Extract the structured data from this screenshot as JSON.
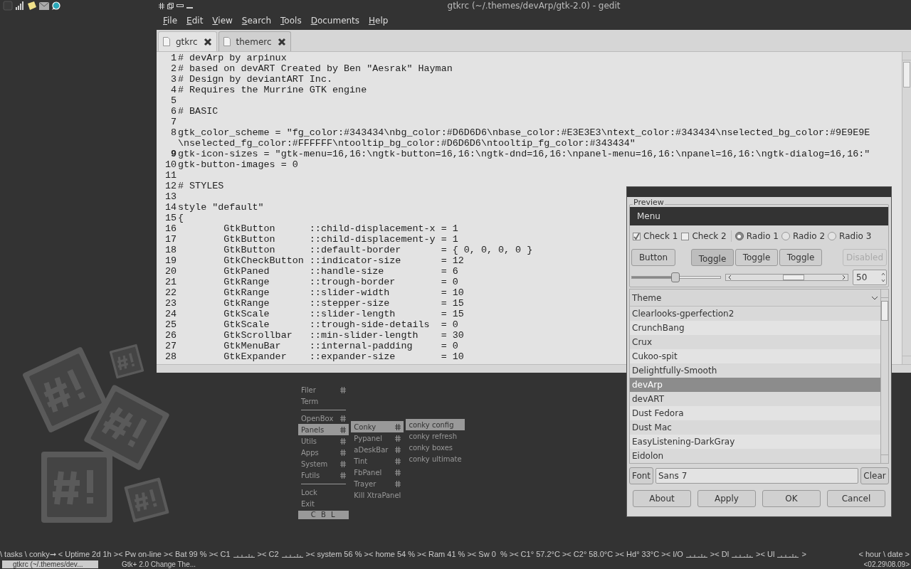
{
  "gedit": {
    "title": "gtkrc (~/.themes/devArp/gtk-2.0) - gedit",
    "menu": [
      "File",
      "Edit",
      "View",
      "Search",
      "Tools",
      "Documents",
      "Help"
    ],
    "tabs": [
      {
        "label": "gtkrc",
        "selected": true
      },
      {
        "label": "themerc",
        "selected": false
      }
    ],
    "lines": [
      {
        "number": "1",
        "text": "# devArp by arpinux",
        "current": false
      },
      {
        "number": "2",
        "text": "# based on devART Created by Ben \"Aesrak\" Hayman",
        "current": false
      },
      {
        "number": "3",
        "text": "# Design by deviantART Inc.",
        "current": false
      },
      {
        "number": "4",
        "text": "# Requires the Murrine GTK engine",
        "current": false
      },
      {
        "number": "5",
        "current": false
      },
      {
        "number": "6",
        "text": "# BASIC",
        "current": false
      },
      {
        "number": "7",
        "current": false
      },
      {
        "number": "8",
        "text": "gtk_color_scheme = \"fg_color:#343434\\nbg_color:#D6D6D6\\nbase_color:#E3E3E3\\ntext_color:#343434\\nselected_bg_color:#9E9E9E",
        "continuation": "\\nselected_fg_color:#FFFFFF\\ntooltip_bg_color:#D6D6D6\\ntooltip_fg_color:#343434\"",
        "current": false
      },
      {
        "number": "9",
        "text": "gtk-icon-sizes = \"gtk-menu=16,16:\\ngtk-button=16,16:\\ngtk-dnd=16,16:\\npanel-menu=16,16:\\npanel=16,16:\\ngtk-dialog=16,16:\"",
        "current": true
      },
      {
        "number": "10",
        "text": "gtk-button-images = 0",
        "current": false
      },
      {
        "number": "11",
        "current": false
      },
      {
        "number": "12",
        "text": "# STYLES",
        "current": false
      },
      {
        "number": "13",
        "current": false
      },
      {
        "number": "14",
        "text": "style \"default\"",
        "current": false
      },
      {
        "number": "15",
        "text": "{",
        "current": false
      },
      {
        "number": "16",
        "text": "\tGtkButton      ::child-displacement-x = 1",
        "current": false
      },
      {
        "number": "17",
        "text": "\tGtkButton      ::child-displacement-y = 1",
        "current": false
      },
      {
        "number": "18",
        "text": "\tGtkButton      ::default-border       = { 0, 0, 0, 0 }",
        "current": false
      },
      {
        "number": "19",
        "text": "\tGtkCheckButton ::indicator-size       = 12",
        "current": false
      },
      {
        "number": "20",
        "text": "\tGtkPaned       ::handle-size          = 6",
        "current": false
      },
      {
        "number": "21",
        "text": "\tGtkRange       ::trough-border        = 0",
        "current": false
      },
      {
        "number": "22",
        "text": "\tGtkRange       ::slider-width         = 10",
        "current": false
      },
      {
        "number": "23",
        "text": "\tGtkRange       ::stepper-size         = 15",
        "current": false
      },
      {
        "number": "24",
        "text": "\tGtkScale       ::slider-length        = 15",
        "current": false
      },
      {
        "number": "25",
        "text": "\tGtkScale       ::trough-side-details  = 0",
        "current": false
      },
      {
        "number": "26",
        "text": "\tGtkScrollbar   ::min-slider-length    = 30",
        "current": false
      },
      {
        "number": "27",
        "text": "\tGtkMenuBar     ::internal-padding     = 0",
        "current": false
      },
      {
        "number": "28",
        "text": "\tGtkExpander    ::expander-size        = 10",
        "current": false
      }
    ]
  },
  "menus": [
    {
      "items": [
        {
          "kind": "item",
          "label": "Filer",
          "submenu": true,
          "selected": false
        },
        {
          "kind": "item",
          "label": "Term",
          "submenu": false,
          "selected": false
        },
        {
          "kind": "separator"
        },
        {
          "kind": "item",
          "label": "OpenBox",
          "submenu": true,
          "selected": false
        },
        {
          "kind": "item",
          "label": "Panels",
          "submenu": true,
          "selected": true
        },
        {
          "kind": "item",
          "label": "Utils",
          "submenu": true,
          "selected": false
        },
        {
          "kind": "item",
          "label": "Apps",
          "submenu": true,
          "selected": false
        },
        {
          "kind": "item",
          "label": "System",
          "submenu": true,
          "selected": false
        },
        {
          "kind": "item",
          "label": "Futils",
          "submenu": true,
          "selected": false
        },
        {
          "kind": "separator"
        },
        {
          "kind": "item",
          "label": "Lock",
          "submenu": false,
          "selected": false
        },
        {
          "kind": "item",
          "label": "Exit",
          "submenu": false,
          "selected": false
        },
        {
          "kind": "footer",
          "label": "C B L"
        }
      ]
    },
    {
      "items": [
        {
          "kind": "item",
          "label": "Conky",
          "submenu": true,
          "selected": true
        },
        {
          "kind": "item",
          "label": "Pypanel",
          "submenu": true,
          "selected": false
        },
        {
          "kind": "item",
          "label": "aDeskBar",
          "submenu": true,
          "selected": false
        },
        {
          "kind": "item",
          "label": "Tint",
          "submenu": true,
          "selected": false
        },
        {
          "kind": "item",
          "label": "FbPanel",
          "submenu": true,
          "selected": false
        },
        {
          "kind": "item",
          "label": "Trayer",
          "submenu": true,
          "selected": false
        },
        {
          "kind": "item",
          "label": "Kill XtraPanel",
          "submenu": false,
          "selected": false
        }
      ]
    },
    {
      "items": [
        {
          "kind": "item",
          "label": "conky config",
          "submenu": false,
          "selected": true
        },
        {
          "kind": "item",
          "label": "conky refresh",
          "submenu": false,
          "selected": false
        },
        {
          "kind": "item",
          "label": "conky boxes",
          "submenu": false,
          "selected": false
        },
        {
          "kind": "item",
          "label": "conky ultimate",
          "submenu": false,
          "selected": false
        }
      ]
    }
  ],
  "preview": {
    "frame_label": "Preview",
    "menubar": "Menu",
    "toggles": [
      {
        "kind": "check",
        "label": "Check 1",
        "selected": true
      },
      {
        "kind": "check",
        "label": "Check 2",
        "selected": false
      },
      {
        "kind": "radio",
        "label": "Radio 1",
        "selected": true
      },
      {
        "kind": "radio",
        "label": "Radio 2",
        "selected": false
      },
      {
        "kind": "radio",
        "label": "Radio 3",
        "selected": false
      }
    ],
    "buttons": [
      {
        "kind": "push",
        "label": "Button",
        "on": false,
        "disabled": false
      },
      {
        "kind": "toggle",
        "label": "Toggle",
        "on": true,
        "disabled": false
      },
      {
        "kind": "toggle",
        "label": "Toggle",
        "on": false,
        "disabled": false
      },
      {
        "kind": "toggle",
        "label": "Toggle",
        "on": false,
        "disabled": false
      },
      {
        "kind": "push",
        "label": "Disabled",
        "on": false,
        "disabled": true
      }
    ],
    "slider": {
      "level": 0.49
    },
    "spin": {
      "value": "50"
    },
    "theme_header": "Theme",
    "themes": [
      {
        "name": "Clearlooks-gperfection2",
        "selected": false
      },
      {
        "name": "CrunchBang",
        "selected": false
      },
      {
        "name": "Crux",
        "selected": false
      },
      {
        "name": "Cukoo-spit",
        "selected": false
      },
      {
        "name": "Delightfully-Smooth",
        "selected": false
      },
      {
        "name": "devArp",
        "selected": true
      },
      {
        "name": "devART",
        "selected": false
      },
      {
        "name": "Dust Fedora",
        "selected": false
      },
      {
        "name": "Dust Mac",
        "selected": false
      },
      {
        "name": "EasyListening-DarkGray",
        "selected": false
      },
      {
        "name": "Eidolon",
        "selected": false
      }
    ],
    "font_button": "Font",
    "font_value": "Sans 7",
    "clear_button": "Clear",
    "actions": [
      "About",
      "Apply",
      "OK",
      "Cancel"
    ]
  },
  "conky": [
    {
      "kind": "text",
      "text": "\\ tasks \\ conky➞ < Uptime 2d 1h >< Pw on-line >< Bat 99 % >< C1"
    },
    {
      "kind": "graph"
    },
    {
      "kind": "text",
      "text": ">< C2"
    },
    {
      "kind": "graph"
    },
    {
      "kind": "text",
      "text": ">< system 56 % >< home 54 % >< Ram 41 % >< Sw 0  % >< C1° 57.2°C >< C2° 58.0°C >< Hd° 33°C >< I/O"
    },
    {
      "kind": "graph"
    },
    {
      "kind": "text",
      "text": ">< Dl"
    },
    {
      "kind": "graph"
    },
    {
      "kind": "text",
      "text": ">< Ul"
    },
    {
      "kind": "graph"
    },
    {
      "kind": "text",
      "text": ">"
    }
  ],
  "clock": {
    "label": "< hour \\ date >",
    "value": "<02.29\\08.09>"
  },
  "tasks": [
    {
      "label": "gtkrc (~/.themes/dev...",
      "selected": true
    },
    {
      "label": "Gtk+ 2.0 Change The...",
      "selected": false
    }
  ]
}
